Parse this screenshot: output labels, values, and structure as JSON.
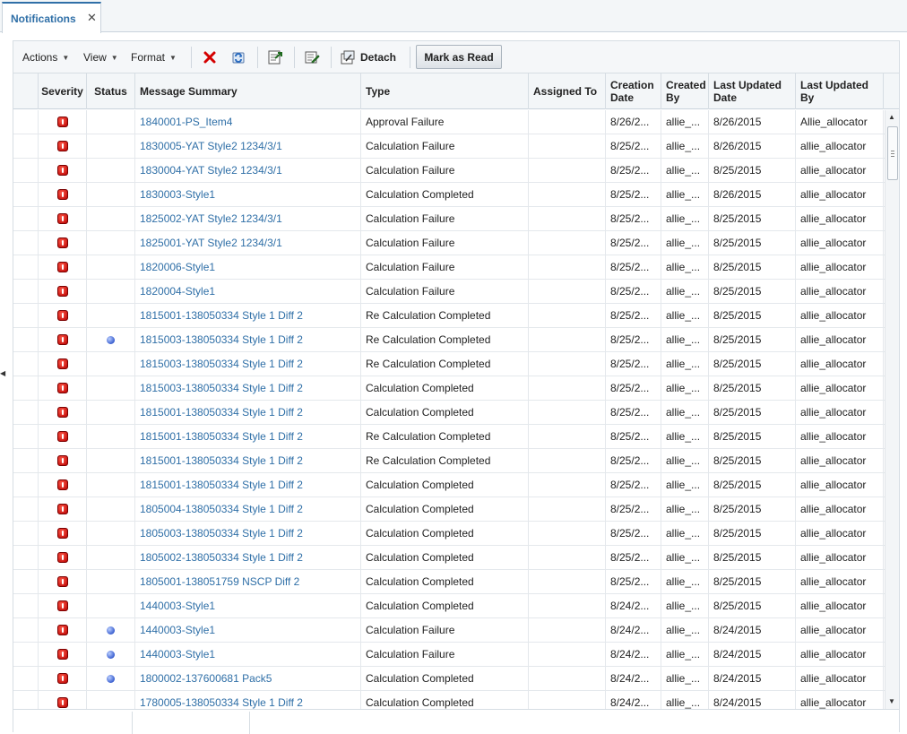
{
  "tab": {
    "label": "Notifications",
    "close": "✕"
  },
  "toolbar": {
    "actions_label": "Actions",
    "view_label": "View",
    "format_label": "Format",
    "detach_label": "Detach",
    "mark_read_label": "Mark as Read"
  },
  "columns": {
    "severity": "Severity",
    "status": "Status",
    "message_summary": "Message Summary",
    "type": "Type",
    "assigned_to": "Assigned To",
    "creation_date": "Creation Date",
    "created_by": "Created By",
    "last_updated_date": "Last Updated Date",
    "last_updated_by": "Last Updated By"
  },
  "rows": [
    {
      "status": "",
      "summary": "1840001-PS_Item4",
      "type": "Approval Failure",
      "assigned": "",
      "created": "8/26/2...",
      "created_by": "allie_...",
      "updated": "8/26/2015",
      "updated_by": "Allie_allocator"
    },
    {
      "status": "",
      "summary": "1830005-YAT Style2 1234/3/1",
      "type": "Calculation Failure",
      "assigned": "",
      "created": "8/25/2...",
      "created_by": "allie_...",
      "updated": "8/26/2015",
      "updated_by": "allie_allocator"
    },
    {
      "status": "",
      "summary": "1830004-YAT Style2 1234/3/1",
      "type": "Calculation Failure",
      "assigned": "",
      "created": "8/25/2...",
      "created_by": "allie_...",
      "updated": "8/25/2015",
      "updated_by": "allie_allocator"
    },
    {
      "status": "",
      "summary": "1830003-Style1",
      "type": "Calculation Completed",
      "assigned": "",
      "created": "8/25/2...",
      "created_by": "allie_...",
      "updated": "8/26/2015",
      "updated_by": "allie_allocator"
    },
    {
      "status": "",
      "summary": "1825002-YAT Style2 1234/3/1",
      "type": "Calculation Failure",
      "assigned": "",
      "created": "8/25/2...",
      "created_by": "allie_...",
      "updated": "8/25/2015",
      "updated_by": "allie_allocator"
    },
    {
      "status": "",
      "summary": "1825001-YAT Style2 1234/3/1",
      "type": "Calculation Failure",
      "assigned": "",
      "created": "8/25/2...",
      "created_by": "allie_...",
      "updated": "8/25/2015",
      "updated_by": "allie_allocator"
    },
    {
      "status": "",
      "summary": "1820006-Style1",
      "type": "Calculation Failure",
      "assigned": "",
      "created": "8/25/2...",
      "created_by": "allie_...",
      "updated": "8/25/2015",
      "updated_by": "allie_allocator"
    },
    {
      "status": "",
      "summary": "1820004-Style1",
      "type": "Calculation Failure",
      "assigned": "",
      "created": "8/25/2...",
      "created_by": "allie_...",
      "updated": "8/25/2015",
      "updated_by": "allie_allocator"
    },
    {
      "status": "",
      "summary": "1815001-138050334 Style 1 Diff 2",
      "type": "Re Calculation Completed",
      "assigned": "",
      "created": "8/25/2...",
      "created_by": "allie_...",
      "updated": "8/25/2015",
      "updated_by": "allie_allocator"
    },
    {
      "status": "unread",
      "summary": "1815003-138050334 Style 1 Diff 2",
      "type": "Re Calculation Completed",
      "assigned": "",
      "created": "8/25/2...",
      "created_by": "allie_...",
      "updated": "8/25/2015",
      "updated_by": "allie_allocator"
    },
    {
      "status": "",
      "summary": "1815003-138050334 Style 1 Diff 2",
      "type": "Re Calculation Completed",
      "assigned": "",
      "created": "8/25/2...",
      "created_by": "allie_...",
      "updated": "8/25/2015",
      "updated_by": "allie_allocator"
    },
    {
      "status": "",
      "summary": "1815003-138050334 Style 1 Diff 2",
      "type": "Calculation Completed",
      "assigned": "",
      "created": "8/25/2...",
      "created_by": "allie_...",
      "updated": "8/25/2015",
      "updated_by": "allie_allocator"
    },
    {
      "status": "",
      "summary": "1815001-138050334 Style 1 Diff 2",
      "type": "Calculation Completed",
      "assigned": "",
      "created": "8/25/2...",
      "created_by": "allie_...",
      "updated": "8/25/2015",
      "updated_by": "allie_allocator"
    },
    {
      "status": "",
      "summary": "1815001-138050334 Style 1 Diff 2",
      "type": "Re Calculation Completed",
      "assigned": "",
      "created": "8/25/2...",
      "created_by": "allie_...",
      "updated": "8/25/2015",
      "updated_by": "allie_allocator"
    },
    {
      "status": "",
      "summary": "1815001-138050334 Style 1 Diff 2",
      "type": "Re Calculation Completed",
      "assigned": "",
      "created": "8/25/2...",
      "created_by": "allie_...",
      "updated": "8/25/2015",
      "updated_by": "allie_allocator"
    },
    {
      "status": "",
      "summary": "1815001-138050334 Style 1 Diff 2",
      "type": "Calculation Completed",
      "assigned": "",
      "created": "8/25/2...",
      "created_by": "allie_...",
      "updated": "8/25/2015",
      "updated_by": "allie_allocator"
    },
    {
      "status": "",
      "summary": "1805004-138050334 Style 1 Diff 2",
      "type": "Calculation Completed",
      "assigned": "",
      "created": "8/25/2...",
      "created_by": "allie_...",
      "updated": "8/25/2015",
      "updated_by": "allie_allocator"
    },
    {
      "status": "",
      "summary": "1805003-138050334 Style 1 Diff 2",
      "type": "Calculation Completed",
      "assigned": "",
      "created": "8/25/2...",
      "created_by": "allie_...",
      "updated": "8/25/2015",
      "updated_by": "allie_allocator"
    },
    {
      "status": "",
      "summary": "1805002-138050334 Style 1 Diff 2",
      "type": "Calculation Completed",
      "assigned": "",
      "created": "8/25/2...",
      "created_by": "allie_...",
      "updated": "8/25/2015",
      "updated_by": "allie_allocator"
    },
    {
      "status": "",
      "summary": "1805001-138051759 NSCP Diff 2",
      "type": "Calculation Completed",
      "assigned": "",
      "created": "8/25/2...",
      "created_by": "allie_...",
      "updated": "8/25/2015",
      "updated_by": "allie_allocator"
    },
    {
      "status": "",
      "summary": "1440003-Style1",
      "type": "Calculation Completed",
      "assigned": "",
      "created": "8/24/2...",
      "created_by": "allie_...",
      "updated": "8/25/2015",
      "updated_by": "allie_allocator"
    },
    {
      "status": "unread",
      "summary": "1440003-Style1",
      "type": "Calculation Failure",
      "assigned": "",
      "created": "8/24/2...",
      "created_by": "allie_...",
      "updated": "8/24/2015",
      "updated_by": "allie_allocator"
    },
    {
      "status": "unread",
      "summary": "1440003-Style1",
      "type": "Calculation Failure",
      "assigned": "",
      "created": "8/24/2...",
      "created_by": "allie_...",
      "updated": "8/24/2015",
      "updated_by": "allie_allocator"
    },
    {
      "status": "unread",
      "summary": "1800002-137600681 Pack5",
      "type": "Calculation Completed",
      "assigned": "",
      "created": "8/24/2...",
      "created_by": "allie_...",
      "updated": "8/24/2015",
      "updated_by": "allie_allocator"
    },
    {
      "status": "",
      "summary": "1780005-138050334 Style 1 Diff 2",
      "type": "Calculation Completed",
      "assigned": "",
      "created": "8/24/2...",
      "created_by": "allie_...",
      "updated": "8/24/2015",
      "updated_by": "allie_allocator"
    }
  ],
  "icons": {
    "severity": "error-icon",
    "unread": "unread-dot-icon"
  },
  "colors": {
    "accent": "#2f6fa7",
    "error": "#cc0000",
    "unread": "#3a5fd0"
  }
}
